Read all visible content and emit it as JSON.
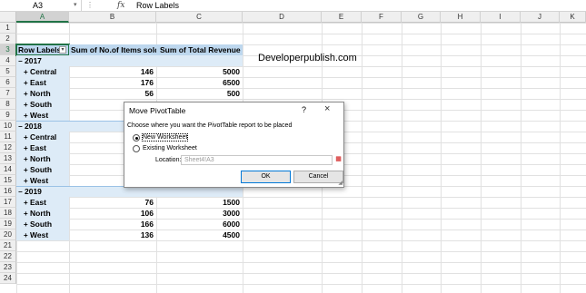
{
  "formula_bar": {
    "name_box": "A3",
    "name_box_icon": "dropdown-arrow",
    "icons": [
      "cancel-icon",
      "enter-icon"
    ],
    "fx": "fx",
    "value": "Row Labels"
  },
  "columns": [
    "A",
    "B",
    "C",
    "D",
    "E",
    "F",
    "G",
    "H",
    "I",
    "J",
    "K"
  ],
  "rows": [
    "1",
    "2",
    "3",
    "4",
    "5",
    "6",
    "7",
    "8",
    "9",
    "10",
    "11",
    "12",
    "13",
    "14",
    "15",
    "16",
    "17",
    "18",
    "19",
    "20",
    "21",
    "22",
    "23",
    "24"
  ],
  "pivot": {
    "header": {
      "row_labels": "Row Labels",
      "filter_icon": "▾",
      "items_sold": "Sum of No.of Items sold",
      "revenue": "Sum of Total Revenue"
    },
    "rows": [
      {
        "label": "2017",
        "level": "year",
        "items": "",
        "revenue": ""
      },
      {
        "label": "Central",
        "level": "region",
        "items": "146",
        "revenue": "5000"
      },
      {
        "label": "East",
        "level": "region",
        "items": "176",
        "revenue": "6500"
      },
      {
        "label": "North",
        "level": "region",
        "items": "56",
        "revenue": "500"
      },
      {
        "label": "South",
        "level": "region",
        "items": "",
        "revenue": ""
      },
      {
        "label": "West",
        "level": "region",
        "items": "",
        "revenue": ""
      },
      {
        "label": "2018",
        "level": "year",
        "items": "",
        "revenue": ""
      },
      {
        "label": "Central",
        "level": "region",
        "items": "",
        "revenue": ""
      },
      {
        "label": "East",
        "level": "region",
        "items": "",
        "revenue": ""
      },
      {
        "label": "North",
        "level": "region",
        "items": "",
        "revenue": ""
      },
      {
        "label": "South",
        "level": "region",
        "items": "",
        "revenue": ""
      },
      {
        "label": "West",
        "level": "region",
        "items": "",
        "revenue": ""
      },
      {
        "label": "2019",
        "level": "year",
        "items": "",
        "revenue": ""
      },
      {
        "label": "East",
        "level": "region",
        "items": "76",
        "revenue": "1500"
      },
      {
        "label": "North",
        "level": "region",
        "items": "106",
        "revenue": "3000"
      },
      {
        "label": "South",
        "level": "region",
        "items": "166",
        "revenue": "6000"
      },
      {
        "label": "West",
        "level": "region",
        "items": "136",
        "revenue": "4500"
      }
    ],
    "collapse_symbol": "−",
    "expand_symbol": "+"
  },
  "watermark": "Developerpublish.com",
  "dialog": {
    "title": "Move PivotTable",
    "help": "?",
    "close_icon": "×",
    "description": "Choose where you want the PivotTable report to be placed",
    "option_new": "New Worksheet",
    "option_existing": "Existing Worksheet",
    "selected_option": "New Worksheet",
    "location_label": "Location:",
    "location_value": "Sheet4!A3",
    "collapse_icon": "range-selector-icon",
    "ok": "OK",
    "cancel": "Cancel",
    "grip": "resize-grip-icon"
  }
}
